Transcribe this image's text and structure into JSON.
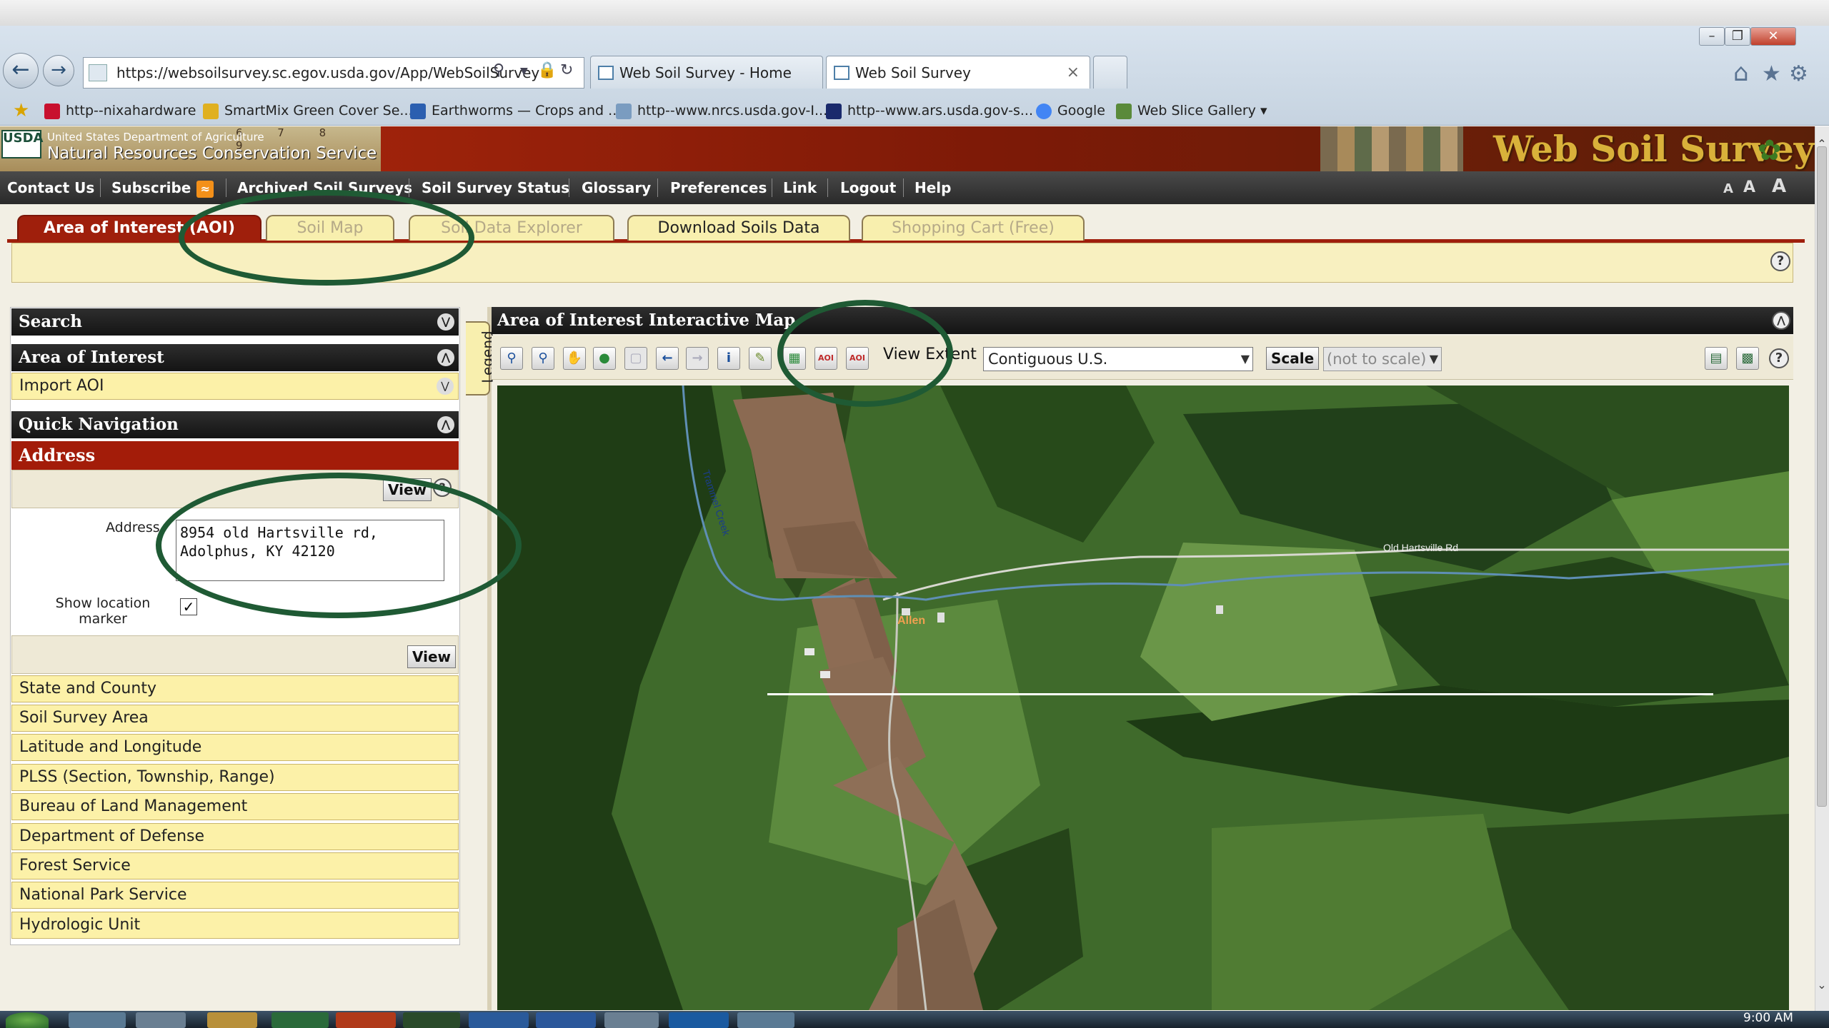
{
  "browser": {
    "url": "https://websoilsurvey.sc.egov.usda.gov/App/WebSoilSurvey",
    "tabs": [
      {
        "label": "Web Soil Survey - Home"
      },
      {
        "label": "Web Soil Survey"
      }
    ],
    "favorites": [
      {
        "label": "http--nixahardware",
        "color": "#c8102e"
      },
      {
        "label": "SmartMix  Green Cover Se...",
        "color": "#e0b020"
      },
      {
        "label": "Earthworms — Crops and ...",
        "color": "#2b5fb0"
      },
      {
        "label": "http--www.nrcs.usda.gov-I...",
        "color": "#7a9cc0"
      },
      {
        "label": "http--www.ars.usda.gov-s...",
        "color": "#1a2a6c"
      },
      {
        "label": "Google",
        "color": "#4285f4"
      },
      {
        "label": "Web Slice Gallery ▾",
        "color": "#5a8a3a"
      }
    ]
  },
  "site": {
    "agency_logo": "USDA",
    "agency_line1": "United States Department of Agriculture",
    "agency_line2": "Natural Resources Conservation Service",
    "title": "Web Soil Survey",
    "ruler_marks": "6 7 8 9",
    "menu": [
      {
        "label": "Contact Us"
      },
      {
        "label": "Subscribe"
      },
      {
        "label": "Archived Soil Surveys"
      },
      {
        "label": "Soil Survey Status"
      },
      {
        "label": "Glossary"
      },
      {
        "label": "Preferences"
      },
      {
        "label": "Link"
      },
      {
        "label": "Logout"
      },
      {
        "label": "Help"
      }
    ],
    "font_sizes": [
      "A",
      "A",
      "A"
    ]
  },
  "tabs": [
    {
      "label": "Area of Interest (AOI)",
      "state": "active"
    },
    {
      "label": "Soil Map",
      "state": "disabled"
    },
    {
      "label": "Soil Data Explorer",
      "state": "disabled"
    },
    {
      "label": "Download Soils Data",
      "state": "inactive"
    },
    {
      "label": "Shopping Cart (Free)",
      "state": "disabled"
    }
  ],
  "left_panel": {
    "search": "Search",
    "area_of_interest": "Area of Interest",
    "import_aoi": "Import AOI",
    "quick_navigation": "Quick Navigation",
    "address_header": "Address",
    "view": "View",
    "address_label": "Address",
    "address_value": "8954 old Hartsville rd,\nAdolphus, KY 42120",
    "show_marker_label": "Show location marker",
    "show_marker_checked": true,
    "nav_items": [
      {
        "label": "State and County"
      },
      {
        "label": "Soil Survey Area"
      },
      {
        "label": "Latitude and Longitude"
      },
      {
        "label": "PLSS (Section, Township, Range)"
      },
      {
        "label": "Bureau of Land Management"
      },
      {
        "label": "Department of Defense"
      },
      {
        "label": "Forest Service"
      },
      {
        "label": "National Park Service"
      },
      {
        "label": "Hydrologic Unit"
      }
    ]
  },
  "legend_label": "Legend",
  "map_panel": {
    "title": "Area of Interest Interactive Map",
    "view_extent_label": "View Extent",
    "view_extent_value": "Contiguous U.S.",
    "scale_button": "Scale",
    "scale_value": "(not to scale)",
    "labels": {
      "road": "Old Hartsville Rd",
      "creek": "Trammel Creek",
      "place": "Allen"
    }
  },
  "taskbar": {
    "clock": "9:00 AM"
  },
  "colors": {
    "active_tab": "#9f1f0c",
    "panel_row": "#fcf1a8",
    "annotation_ring": "#1f5a34",
    "menu_bar": "#2a2a2a"
  }
}
